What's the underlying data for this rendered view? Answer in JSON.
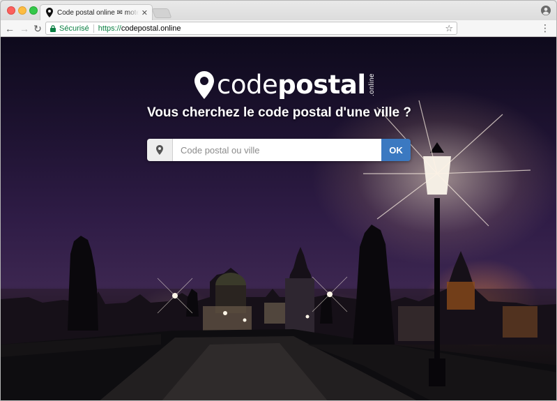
{
  "browser": {
    "tab_title": "Code postal online ✉ moteur de recherche",
    "secure_label": "Sécurisé",
    "url_scheme": "https://",
    "url_host": "codepostal.online"
  },
  "page": {
    "logo": {
      "code": "code",
      "postal": "postal",
      "tld": ".online"
    },
    "tagline": "Vous cherchez le code postal d'une ville ?",
    "search": {
      "placeholder": "Code postal ou ville",
      "button_label": "OK"
    }
  },
  "colors": {
    "accent": "#3b79c1",
    "secure_green": "#0b8043"
  },
  "icons": [
    "location-pin-icon",
    "lock-icon",
    "star-icon",
    "menu-icon",
    "profile-icon",
    "back-icon",
    "forward-icon",
    "reload-icon",
    "close-icon"
  ]
}
